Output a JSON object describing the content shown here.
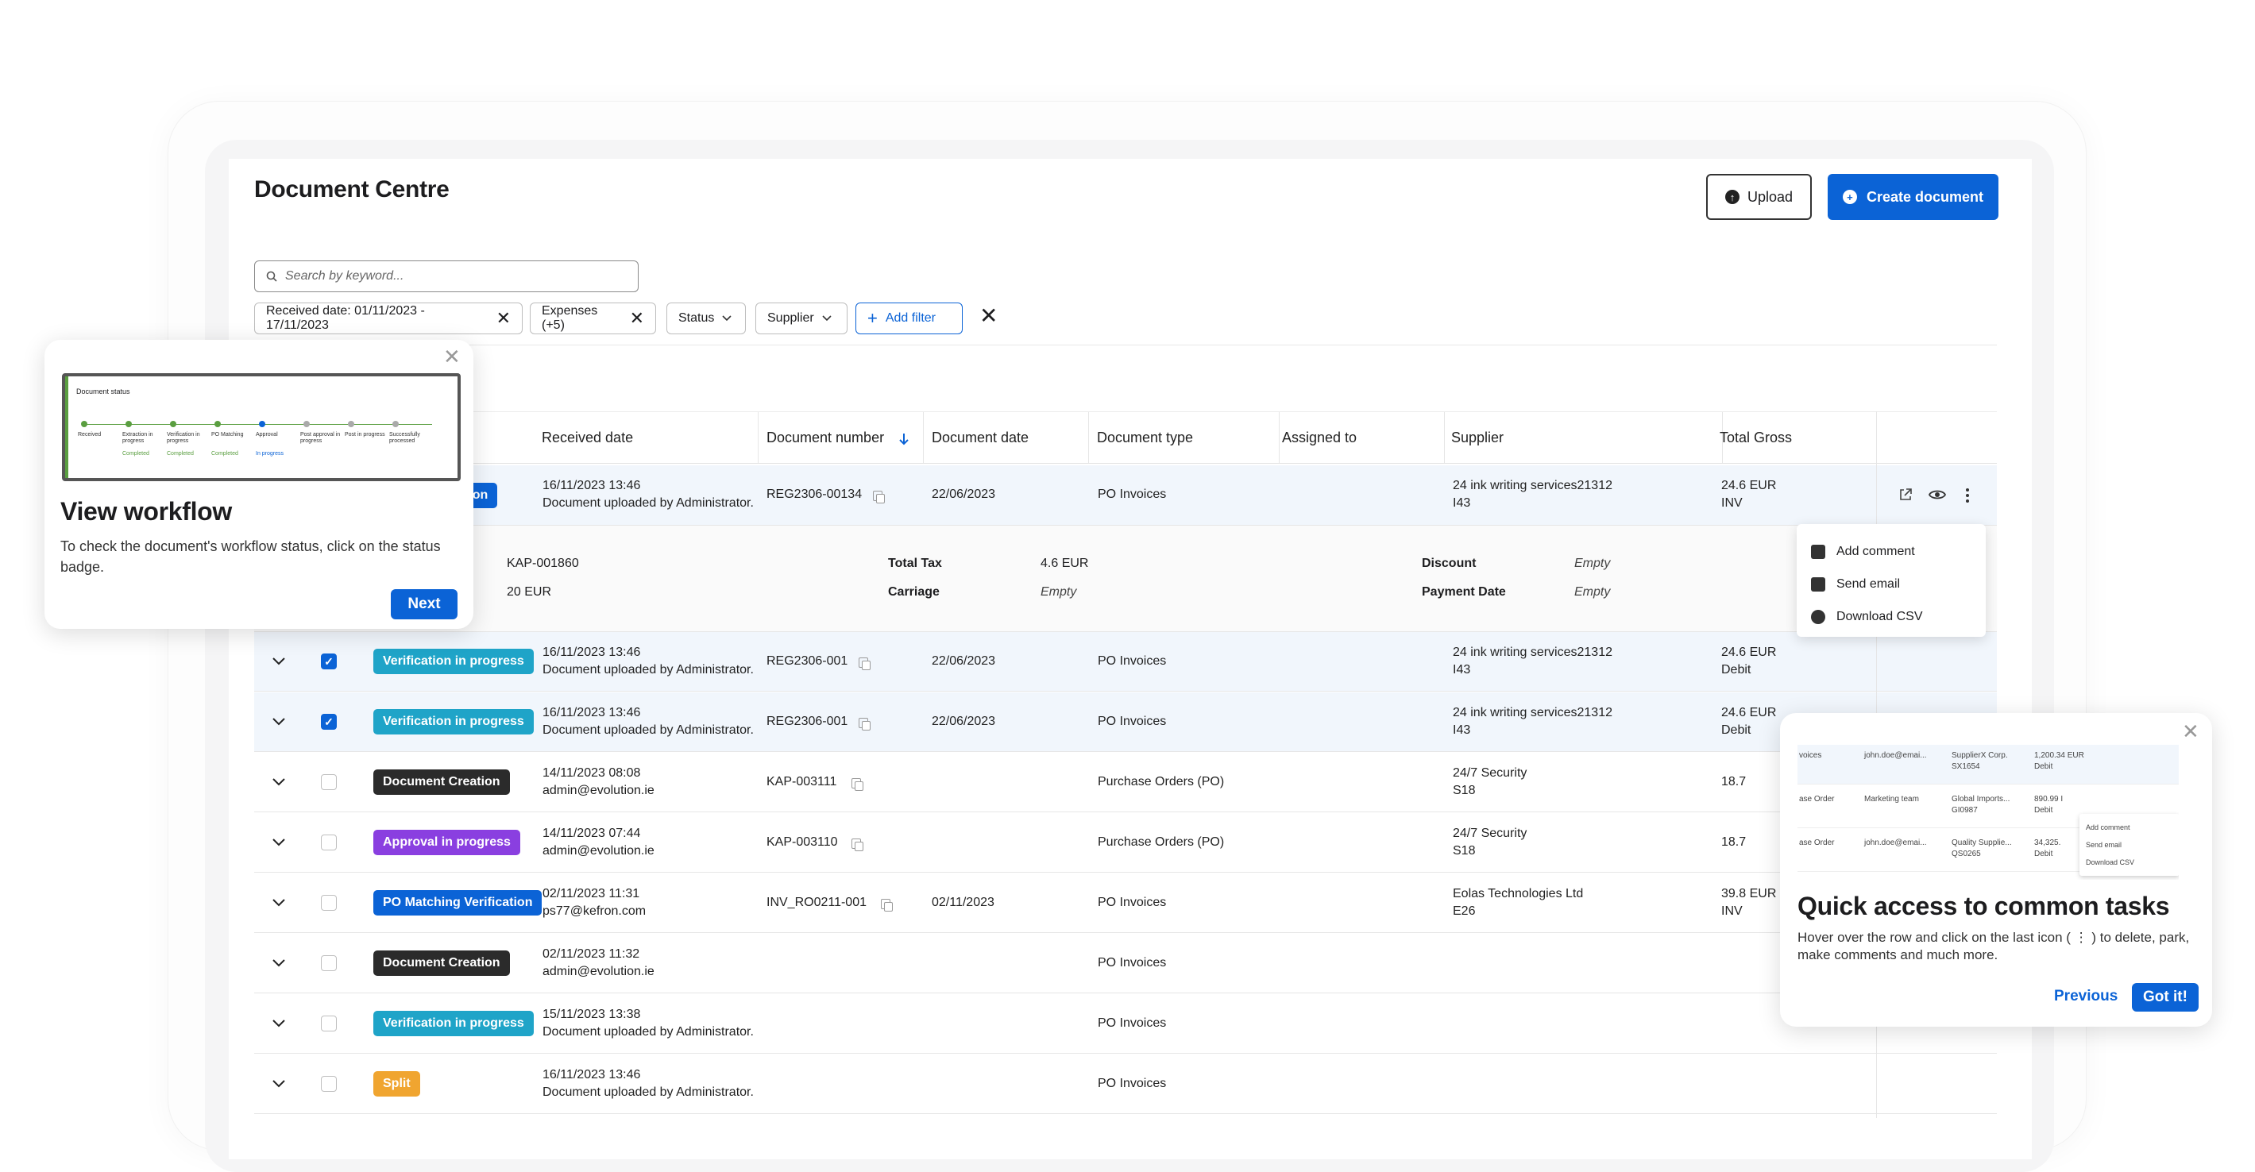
{
  "app": {
    "title": "Document Centre"
  },
  "header": {
    "upload_label": "Upload",
    "create_label": "Create document",
    "upload_icon": "arrow-up-circle-icon",
    "create_icon": "plus-circle-icon"
  },
  "search": {
    "placeholder": "Search by keyword..."
  },
  "filters": {
    "received": "Received date: 01/11/2023 - 17/11/2023",
    "expenses": "Expenses (+5)",
    "status": "Status",
    "supplier": "Supplier",
    "add_filter": "Add filter"
  },
  "columns": [
    "Received date",
    "Document number",
    "Document date",
    "Document type",
    "Assigned to",
    "Supplier",
    "Total Gross"
  ],
  "rows": [
    {
      "badge": "Verification",
      "badge_color": "#0b63d6",
      "received": "16/11/2023 13:46",
      "received_sub": "Document uploaded by Administrator.",
      "doc_number": "REG2306-00134",
      "doc_date": "22/06/2023",
      "doc_type": "PO Invoices",
      "supplier": "24 ink writing services21312",
      "supplier_sub": "I43",
      "gross": "24.6 EUR",
      "gross_sub": "INV"
    },
    {
      "badge": "Verification in progress",
      "badge_color": "#1fa4c8",
      "received": "16/11/2023 13:46",
      "received_sub": "Document uploaded by Administrator.",
      "doc_number": "REG2306-001",
      "doc_date": "22/06/2023",
      "doc_type": "PO Invoices",
      "supplier": "24 ink writing services21312",
      "supplier_sub": "I43",
      "gross": "24.6 EUR",
      "gross_sub": "Debit"
    },
    {
      "badge": "Verification in progress",
      "badge_color": "#1fa4c8",
      "received": "16/11/2023 13:46",
      "received_sub": "Document uploaded by Administrator.",
      "doc_number": "REG2306-001",
      "doc_date": "22/06/2023",
      "doc_type": "PO Invoices",
      "supplier": "24 ink writing services21312",
      "supplier_sub": "I43",
      "gross": "24.6 EUR",
      "gross_sub": "Debit"
    },
    {
      "badge": "Document Creation",
      "badge_color": "#2b2b2b",
      "received": "14/11/2023 08:08",
      "received_sub": "admin@evolution.ie",
      "doc_number": "KAP-003111",
      "doc_date": "",
      "doc_type": "Purchase Orders (PO)",
      "supplier": "24/7 Security",
      "supplier_sub": "S18",
      "gross": "18.7",
      "gross_sub": ""
    },
    {
      "badge": "Approval in progress",
      "badge_color": "#8a3fe0",
      "received": "14/11/2023 07:44",
      "received_sub": "admin@evolution.ie",
      "doc_number": "KAP-003110",
      "doc_date": "",
      "doc_type": "Purchase Orders (PO)",
      "supplier": "24/7 Security",
      "supplier_sub": "S18",
      "gross": "18.7",
      "gross_sub": ""
    },
    {
      "badge": "PO Matching Verification",
      "badge_color": "#0b63d6",
      "received": "02/11/2023 11:31",
      "received_sub": "ps77@kefron.com",
      "doc_number": "INV_RO0211-001",
      "doc_date": "02/11/2023",
      "doc_type": "PO Invoices",
      "supplier": "Eolas Technologies Ltd",
      "supplier_sub": "E26",
      "gross": "39.8 EUR",
      "gross_sub": "INV"
    },
    {
      "badge": "Document Creation",
      "badge_color": "#2b2b2b",
      "received": "02/11/2023 11:32",
      "received_sub": "admin@evolution.ie",
      "doc_number": "",
      "doc_date": "",
      "doc_type": "PO Invoices",
      "supplier": "",
      "supplier_sub": "",
      "gross": "",
      "gross_sub": ""
    },
    {
      "badge": "Verification in progress",
      "badge_color": "#1fa4c8",
      "received": "15/11/2023 13:38",
      "received_sub": "Document uploaded by Administrator.",
      "doc_number": "",
      "doc_date": "",
      "doc_type": "PO Invoices",
      "supplier": "",
      "supplier_sub": "",
      "gross": "",
      "gross_sub": ""
    },
    {
      "badge": "Split",
      "badge_color": "#f0a530",
      "received": "16/11/2023 13:46",
      "received_sub": "Document uploaded by Administrator.",
      "doc_number": "",
      "doc_date": "",
      "doc_type": "PO Invoices",
      "supplier": "",
      "supplier_sub": "",
      "gross": "",
      "gross_sub": ""
    }
  ],
  "expanded": {
    "ref": "KAP-001860",
    "amount": "20 EUR",
    "total_tax_label": "Total Tax",
    "total_tax": "4.6 EUR",
    "carriage_label": "Carriage",
    "carriage": "Empty",
    "discount_label": "Discount",
    "discount": "Empty",
    "payment_date_label": "Payment Date",
    "payment_date": "Empty"
  },
  "context_menu": [
    {
      "label": "Add comment",
      "icon": "comment-icon"
    },
    {
      "label": "Send email",
      "icon": "email-icon"
    },
    {
      "label": "Download CSV",
      "icon": "download-icon"
    }
  ],
  "workflow_tip": {
    "title": "View workflow",
    "body": "To check the document's workflow status, click on the status badge.",
    "next": "Next",
    "preview_title": "Document status",
    "preview_steps": [
      "Received",
      "Extraction in progress",
      "Verification in progress",
      "PO Matching",
      "Approval",
      "Post approval in progress",
      "Post in progress",
      "Successfully processed"
    ],
    "preview_statuses": [
      "Completed",
      "Completed",
      "Completed",
      "In progress"
    ]
  },
  "tasks_tip": {
    "title": "Quick access to common tasks",
    "body": "Hover over the row and click on the last icon ( ⋮ ) to delete, park, make comments and much more.",
    "previous": "Previous",
    "got_it": "Got it!",
    "preview_rows": [
      {
        "c1": "voices",
        "c2": "john.doe@emai...",
        "c3": "SupplierX Corp.",
        "c3b": "SX1654",
        "c4": "1,200.34 EUR",
        "c4b": "Debit"
      },
      {
        "c1": "ase Order",
        "c2": "Marketing team",
        "c3": "Global Imports...",
        "c3b": "GI0987",
        "c4": "890.99 I",
        "c4b": "Debit"
      },
      {
        "c1": "ase Order",
        "c2": "john.doe@emai...",
        "c3": "Quality Supplie...",
        "c3b": "QS0265",
        "c4": "34,325.",
        "c4b": "Debit"
      }
    ],
    "preview_menu": [
      "Add comment",
      "Send email",
      "Download CSV"
    ]
  },
  "colors": {
    "primary": "#0b63d6",
    "teal": "#1fa4c8",
    "purple": "#8a3fe0",
    "orange": "#f0a530",
    "dark": "#2b2b2b"
  }
}
